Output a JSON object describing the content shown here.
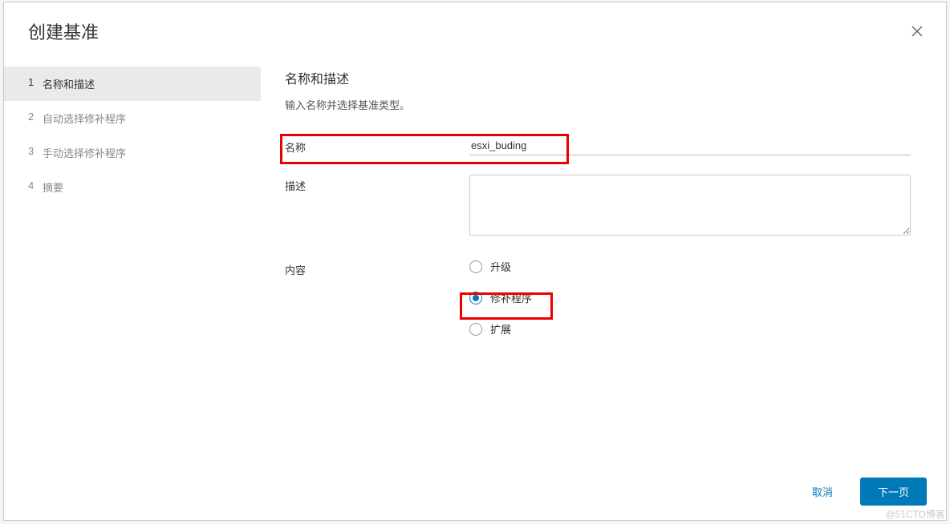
{
  "modal": {
    "title": "创建基准"
  },
  "wizard": {
    "steps": [
      {
        "num": "1",
        "label": "名称和描述",
        "active": true
      },
      {
        "num": "2",
        "label": "自动选择修补程序",
        "active": false
      },
      {
        "num": "3",
        "label": "手动选择修补程序",
        "active": false
      },
      {
        "num": "4",
        "label": "摘要",
        "active": false
      }
    ]
  },
  "form": {
    "section_title": "名称和描述",
    "section_desc": "输入名称并选择基准类型。",
    "name_label": "名称",
    "name_value": "esxi_buding",
    "desc_label": "描述",
    "desc_value": "",
    "content_label": "内容",
    "radios": [
      {
        "label": "升级",
        "checked": false
      },
      {
        "label": "修补程序",
        "checked": true
      },
      {
        "label": "扩展",
        "checked": false
      }
    ]
  },
  "footer": {
    "cancel": "取消",
    "next": "下一页"
  },
  "watermark": "@51CTO博客"
}
